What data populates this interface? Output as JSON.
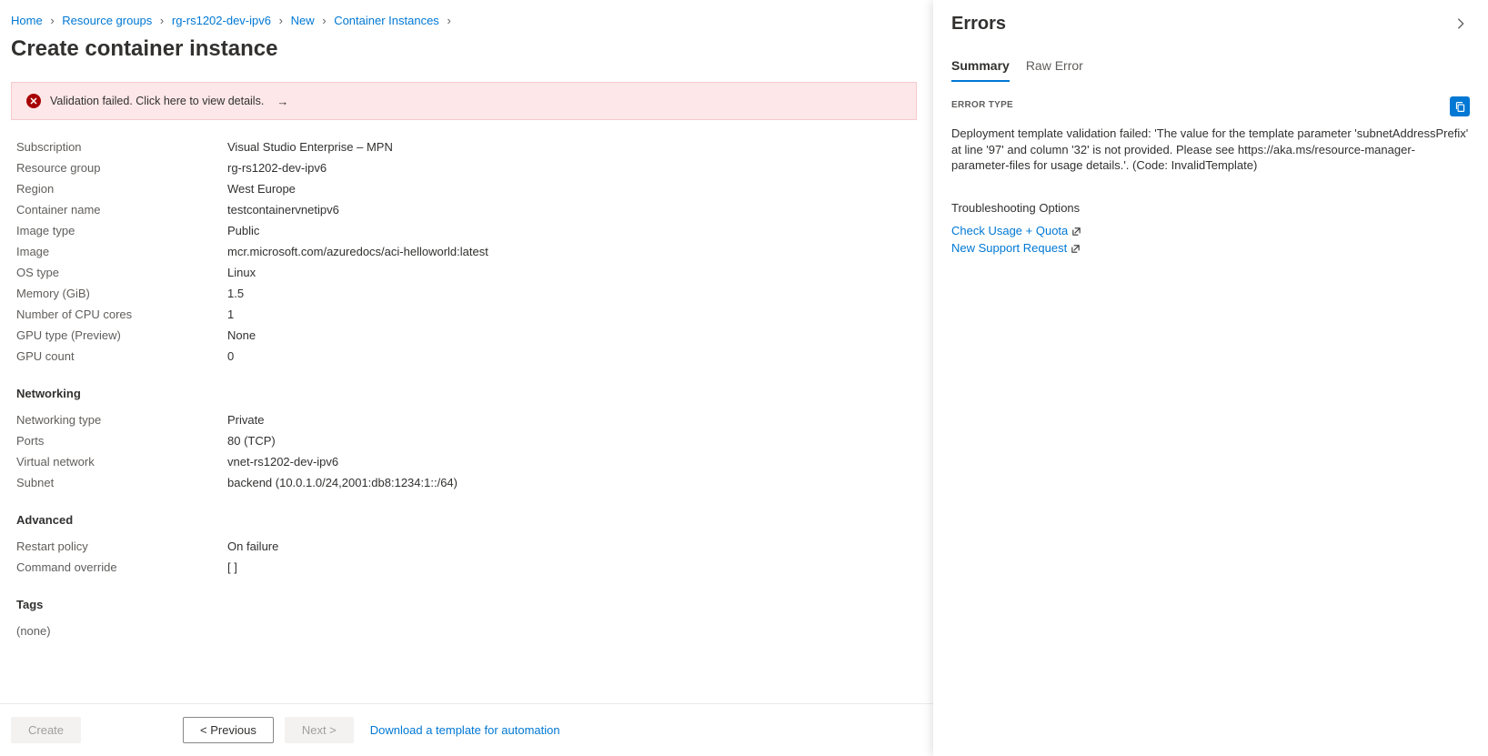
{
  "breadcrumb": [
    {
      "label": "Home"
    },
    {
      "label": "Resource groups"
    },
    {
      "label": "rg-rs1202-dev-ipv6"
    },
    {
      "label": "New"
    },
    {
      "label": "Container Instances"
    }
  ],
  "page_title": "Create container instance",
  "validation_banner": {
    "text": "Validation failed. Click here to view details.",
    "arrow": "→"
  },
  "summary_rows": [
    {
      "label": "Subscription",
      "value": "Visual Studio Enterprise – MPN"
    },
    {
      "label": "Resource group",
      "value": "rg-rs1202-dev-ipv6"
    },
    {
      "label": "Region",
      "value": "West Europe"
    },
    {
      "label": "Container name",
      "value": "testcontainervnetipv6"
    },
    {
      "label": "Image type",
      "value": "Public"
    },
    {
      "label": "Image",
      "value": "mcr.microsoft.com/azuredocs/aci-helloworld:latest"
    },
    {
      "label": "OS type",
      "value": "Linux"
    },
    {
      "label": "Memory (GiB)",
      "value": "1.5"
    },
    {
      "label": "Number of CPU cores",
      "value": "1"
    },
    {
      "label": "GPU type (Preview)",
      "value": "None"
    },
    {
      "label": "GPU count",
      "value": "0"
    }
  ],
  "networking": {
    "heading": "Networking",
    "rows": [
      {
        "label": "Networking type",
        "value": "Private"
      },
      {
        "label": "Ports",
        "value": "80 (TCP)"
      },
      {
        "label": "Virtual network",
        "value": "vnet-rs1202-dev-ipv6"
      },
      {
        "label": "Subnet",
        "value": "backend (10.0.1.0/24,2001:db8:1234:1::/64)"
      }
    ]
  },
  "advanced": {
    "heading": "Advanced",
    "rows": [
      {
        "label": "Restart policy",
        "value": "On failure"
      },
      {
        "label": "Command override",
        "value": "[ ]"
      }
    ]
  },
  "tags": {
    "heading": "Tags",
    "none_text": "(none)"
  },
  "footer": {
    "create": "Create",
    "previous": "< Previous",
    "next": "Next >",
    "download": "Download a template for automation"
  },
  "panel": {
    "title": "Errors",
    "tabs": {
      "summary": "Summary",
      "raw": "Raw Error"
    },
    "error_type_label": "ERROR TYPE",
    "error_message": "Deployment template validation failed: 'The value for the template parameter 'subnetAddressPrefix' at line '97' and column '32' is not provided. Please see https://aka.ms/resource-manager-parameter-files for usage details.'. (Code: InvalidTemplate)",
    "troubleshoot_heading": "Troubleshooting Options",
    "links": {
      "usage_quota": "Check Usage + Quota",
      "support_request": "New Support Request"
    }
  }
}
